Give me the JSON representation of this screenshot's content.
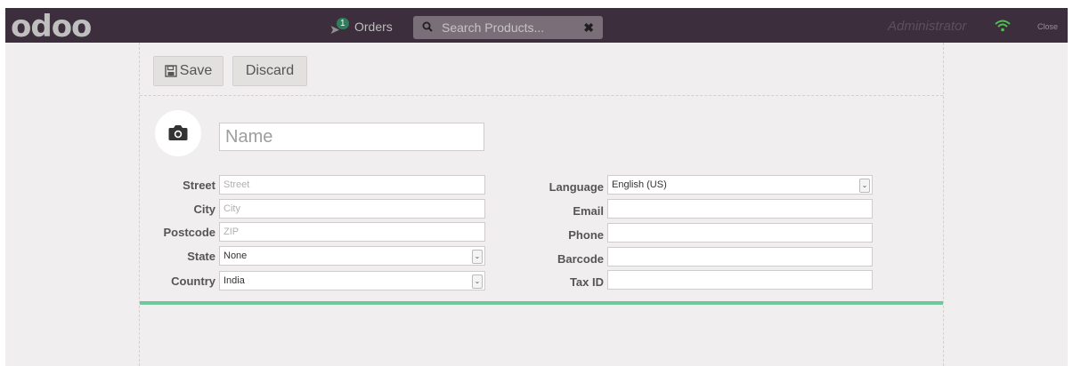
{
  "header": {
    "logo": "odoo",
    "orders_label": "Orders",
    "orders_count": "1",
    "search_placeholder": "Search Products...",
    "user": "Administrator",
    "close_label": "Close"
  },
  "toolbar": {
    "save_label": "Save",
    "discard_label": "Discard"
  },
  "form": {
    "name_placeholder": "Name",
    "left": [
      {
        "label": "Street",
        "placeholder": "Street",
        "value": ""
      },
      {
        "label": "City",
        "placeholder": "City",
        "value": ""
      },
      {
        "label": "Postcode",
        "placeholder": "ZIP",
        "value": ""
      },
      {
        "label": "State",
        "value": "None"
      },
      {
        "label": "Country",
        "value": "India"
      }
    ],
    "right": [
      {
        "label": "Language",
        "value": "English (US)"
      },
      {
        "label": "Email",
        "value": ""
      },
      {
        "label": "Phone",
        "value": ""
      },
      {
        "label": "Barcode",
        "value": ""
      },
      {
        "label": "Tax ID",
        "value": ""
      }
    ]
  },
  "colors": {
    "topbar": "#3c2e3c",
    "accent_green": "#6ec89b",
    "badge_green": "#2e7d5b"
  }
}
